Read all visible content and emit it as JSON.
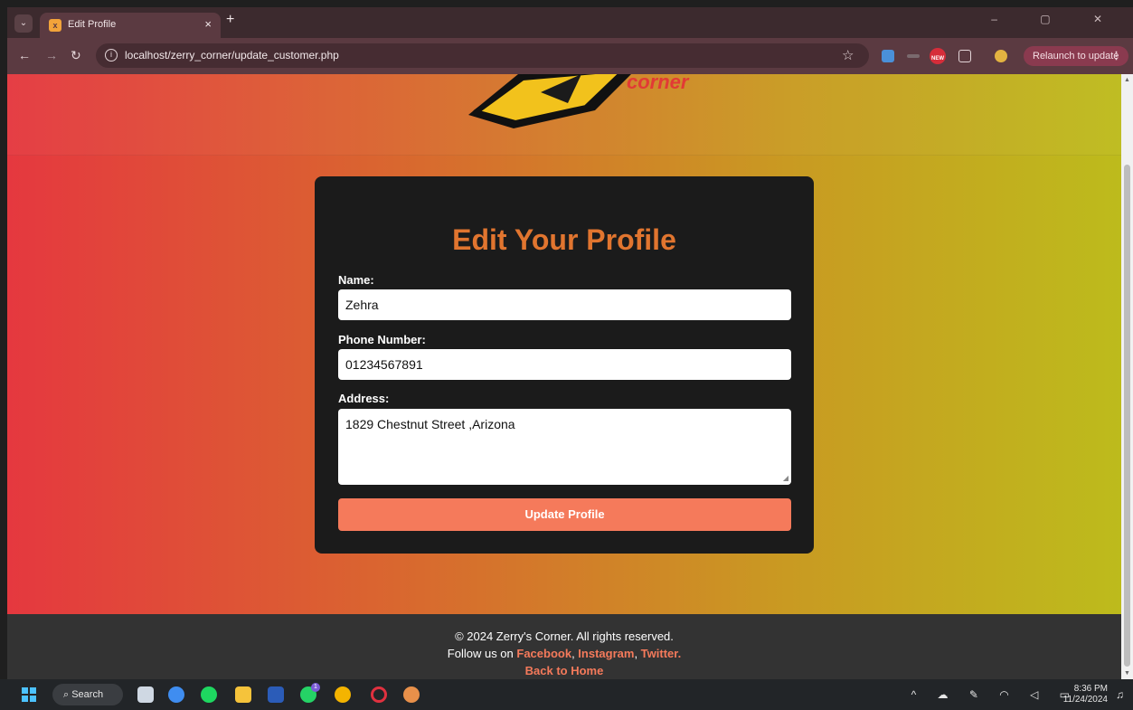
{
  "browser": {
    "tab_title": "Edit Profile",
    "tab_close": "×",
    "new_tab": "+",
    "window_controls": "– ▢ ✕",
    "url": "localhost/zerry_corner/update_customer.php",
    "relaunch_label": "Relaunch to update",
    "extension_badge": "NEW",
    "colors": {
      "chrome_bg": "#5b3a41",
      "relaunch_bg": "#8a3a4f"
    }
  },
  "page": {
    "logo_text": "corner",
    "form": {
      "title": "Edit Your Profile",
      "name_label": "Name:",
      "name_value": "Zehra",
      "phone_label": "Phone Number:",
      "phone_value": "01234567891",
      "address_label": "Address:",
      "address_value": "1829 Chestnut Street ,Arizona",
      "submit_label": "Update Profile"
    },
    "footer": {
      "copyright": "© 2024 Zerry's Corner. All rights reserved.",
      "follow_prefix": "Follow us on ",
      "facebook": "Facebook",
      "instagram": "Instagram",
      "twitter": "Twitter.",
      "sep1": ", ",
      "sep2": ", ",
      "back_home": "Back to Home"
    },
    "colors": {
      "accent": "#f57a5b",
      "title": "#e1752f",
      "card": "#1b1b1b",
      "footer": "#333333"
    }
  },
  "taskbar": {
    "search_label": "Search",
    "time": "8:36 PM",
    "date": "11/24/2024",
    "whatsapp_badge": "1"
  }
}
